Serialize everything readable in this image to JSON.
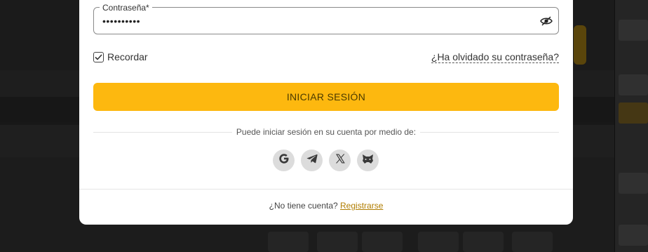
{
  "login": {
    "password_label": "Contraseña*",
    "password_value": "••••••••••",
    "remember_label": "Recordar",
    "remember_checked": true,
    "forgot_link": "¿Ha olvidado su contraseña?",
    "submit_label": "INICIAR SESIÓN",
    "social_caption": "Puede iniciar sesión en su cuenta por medio de:",
    "social_buttons": [
      {
        "name": "google",
        "icon": "google-icon"
      },
      {
        "name": "telegram",
        "icon": "telegram-icon"
      },
      {
        "name": "x",
        "icon": "x-icon"
      },
      {
        "name": "metamask",
        "icon": "fox-icon"
      }
    ],
    "no_account_text": "¿No tiene cuenta?",
    "register_link": "Registrarse"
  },
  "colors": {
    "accent": "#fdb80f",
    "link": "#b07d00",
    "overlay_bg": "#262626"
  }
}
